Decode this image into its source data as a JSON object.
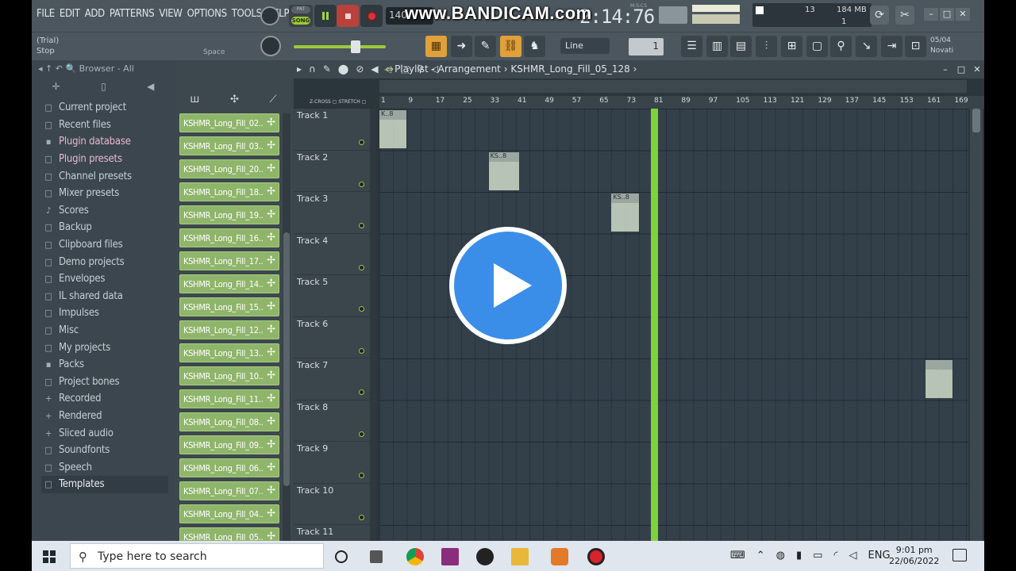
{
  "menu": [
    "FILE",
    "EDIT",
    "ADD",
    "PATTERNS",
    "VIEW",
    "OPTIONS",
    "TOOLS",
    "HELP"
  ],
  "transport": {
    "pat_label": "PAT",
    "song_label": "SONG",
    "tempo": "140",
    "time": "2:14:76",
    "time_label": "M:S:CS"
  },
  "watermark": "www.BANDICAM.com",
  "cpu": {
    "value": "13",
    "memory": "184 MB",
    "voices": "1"
  },
  "hint": {
    "line1": "(Trial)",
    "line2": "Stop",
    "space": "Space"
  },
  "toolbar": {
    "snap": "Line",
    "step": "1",
    "date": "05/04",
    "news": "Novati"
  },
  "browser": {
    "title": "Browser - All",
    "items": [
      {
        "label": "Current project",
        "icon": "□"
      },
      {
        "label": "Recent files",
        "icon": "□"
      },
      {
        "label": "Plugin database",
        "icon": "▪"
      },
      {
        "label": "Plugin presets",
        "icon": "□"
      },
      {
        "label": "Channel presets",
        "icon": "□"
      },
      {
        "label": "Mixer presets",
        "icon": "□"
      },
      {
        "label": "Scores",
        "icon": "♪"
      },
      {
        "label": "Backup",
        "icon": "□"
      },
      {
        "label": "Clipboard files",
        "icon": "□"
      },
      {
        "label": "Demo projects",
        "icon": "□"
      },
      {
        "label": "Envelopes",
        "icon": "□"
      },
      {
        "label": "IL shared data",
        "icon": "□"
      },
      {
        "label": "Impulses",
        "icon": "□"
      },
      {
        "label": "Misc",
        "icon": "□"
      },
      {
        "label": "My projects",
        "icon": "□"
      },
      {
        "label": "Packs",
        "icon": "▪"
      },
      {
        "label": "Project bones",
        "icon": "□"
      },
      {
        "label": "Recorded",
        "icon": "+"
      },
      {
        "label": "Rendered",
        "icon": "+"
      },
      {
        "label": "Sliced audio",
        "icon": "+"
      },
      {
        "label": "Soundfonts",
        "icon": "□"
      },
      {
        "label": "Speech",
        "icon": "□"
      },
      {
        "label": "Templates",
        "icon": "□"
      }
    ]
  },
  "channels": [
    "KSHMR_Long_Fill_02...",
    "KSHMR_Long_Fill_03...",
    "KSHMR_Long_Fill_20...",
    "KSHMR_Long_Fill_18...",
    "KSHMR_Long_Fill_19...",
    "KSHMR_Long_Fill_16...",
    "KSHMR_Long_Fill_17...",
    "KSHMR_Long_Fill_14...",
    "KSHMR_Long_Fill_15...",
    "KSHMR_Long_Fill_12...",
    "KSHMR_Long_Fill_13...",
    "KSHMR_Long_Fill_10...",
    "KSHMR_Long_Fill_11...",
    "KSHMR_Long_Fill_08...",
    "KSHMR_Long_Fill_09...",
    "KSHMR_Long_Fill_06...",
    "KSHMR_Long_Fill_07...",
    "KSHMR_Long_Fill_04...",
    "KSHMR_Long_Fill_05..."
  ],
  "playlist": {
    "title": "Playlist - Arrangement",
    "pattern": "KSHMR_Long_Fill_05_128",
    "zcross": "Z-CROSS",
    "stretch": "STRETCH",
    "ruler": [
      "1",
      "9",
      "17",
      "25",
      "33",
      "41",
      "49",
      "57",
      "65",
      "73",
      "81",
      "89",
      "97",
      "105",
      "113",
      "121",
      "129",
      "137",
      "145",
      "153",
      "161",
      "169"
    ],
    "tracks": [
      "Track 1",
      "Track 2",
      "Track 3",
      "Track 4",
      "Track 5",
      "Track 6",
      "Track 7",
      "Track 8",
      "Track 9",
      "Track 10",
      "Track 11"
    ],
    "clips": [
      {
        "label": "K..8",
        "track": 0,
        "start": 1,
        "length": 4,
        "color": "normal"
      },
      {
        "label": "KS..8",
        "track": 1,
        "start": 5,
        "length": 4.5,
        "color": "normal"
      },
      {
        "label": "KS..8",
        "track": 2,
        "start": 9.5,
        "length": 4,
        "color": "normal"
      },
      {
        "label": "",
        "track": 6,
        "start": 21,
        "length": 4,
        "color": "normal"
      },
      {
        "label": "",
        "track": 7,
        "start": 25,
        "length": 1.5,
        "color": "normal"
      },
      {
        "label": "K..8",
        "track": 8,
        "start": 27,
        "length": 4,
        "color": "normal"
      },
      {
        "label": "KS..8",
        "track": 9,
        "start": 31,
        "length": 4,
        "color": "normal"
      },
      {
        "label": "",
        "track": 10,
        "start": 35,
        "length": 1.5,
        "color": "normal"
      },
      {
        "label": "KS..8",
        "track": 9,
        "start": 37.5,
        "length": 4,
        "color": "normal"
      },
      {
        "label": "KS..8",
        "track": 8,
        "start": 41.5,
        "length": 4,
        "color": "normal"
      },
      {
        "label": "KS..8",
        "track": 7,
        "start": 45,
        "length": 4,
        "color": "normal"
      },
      {
        "label": "KS..8",
        "track": 6,
        "start": 49,
        "length": 4,
        "color": "normal"
      },
      {
        "label": "",
        "track": 5,
        "start": 53,
        "length": 1.5,
        "color": "normal"
      },
      {
        "label": "KS..8",
        "track": 4,
        "start": 55,
        "length": 4,
        "color": "normal"
      },
      {
        "label": "KS..8",
        "track": 3,
        "start": 59,
        "length": 4,
        "color": "normal"
      },
      {
        "label": "KS..8",
        "track": 2,
        "start": 63,
        "length": 4,
        "color": "normal"
      },
      {
        "label": "KS..8",
        "track": 1,
        "start": 67,
        "length": 4,
        "color": "normal"
      },
      {
        "label": "KS..8",
        "track": 0,
        "start": 71,
        "length": 4.5,
        "color": "normal"
      },
      {
        "label": "KS..8",
        "track": 1,
        "start": 75,
        "length": 4,
        "color": "red"
      }
    ],
    "playhead_bar": 80.5
  },
  "taskbar": {
    "search_placeholder": "Type here to search",
    "lang": "ENG",
    "time": "9:01 pm",
    "date": "22/06/2022"
  }
}
